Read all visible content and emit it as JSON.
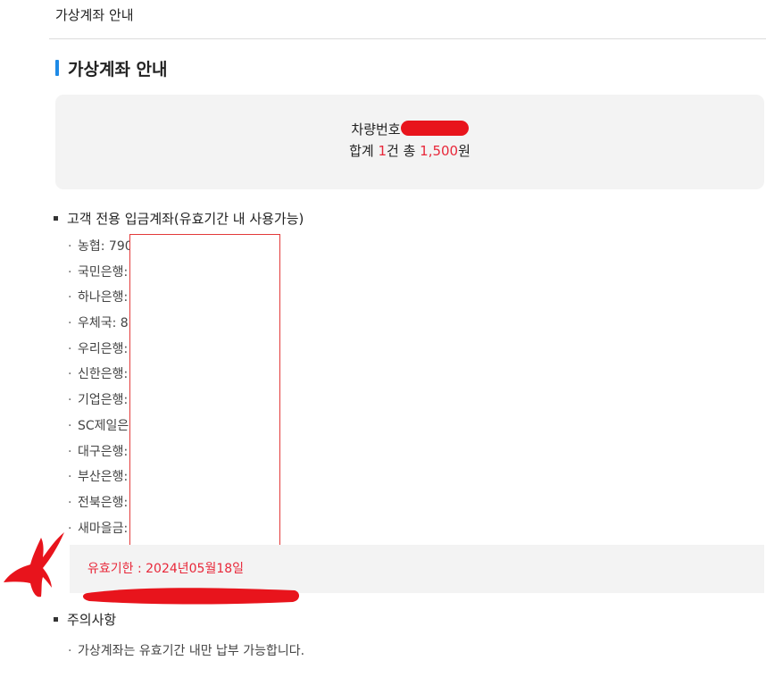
{
  "page": {
    "breadcrumb_title": "가상계좌 안내",
    "section_title": "가상계좌 안내"
  },
  "summary": {
    "plate_label": "차량번호",
    "total_label": "합계",
    "count": "1",
    "count_unit": "건 총",
    "amount": "1,500",
    "currency": "원"
  },
  "accounts": {
    "heading": "고객 전용 입금계좌(유효기간 내 사용가능)",
    "banks": [
      {
        "label": "농협: 790"
      },
      {
        "label": "국민은행:"
      },
      {
        "label": "하나은행:"
      },
      {
        "label": "우체국: 87"
      },
      {
        "label": "우리은행:"
      },
      {
        "label": "신한은행:"
      },
      {
        "label": "기업은행:"
      },
      {
        "label": "SC제일은"
      },
      {
        "label": "대구은행:"
      },
      {
        "label": "부산은행:"
      },
      {
        "label": "전북은행:"
      },
      {
        "label": "새마을금:"
      }
    ],
    "expiry": "유효기한 : 2024년05월18일"
  },
  "notice": {
    "heading": "주의사항",
    "items": [
      "가상계좌는 유효기간 내만 납부 가능합니다."
    ]
  },
  "colors": {
    "accent_bar": "#1e8ae6",
    "highlight_red": "#e8283a",
    "annotation_red": "#e8141c",
    "panel_gray": "#f3f3f3"
  }
}
